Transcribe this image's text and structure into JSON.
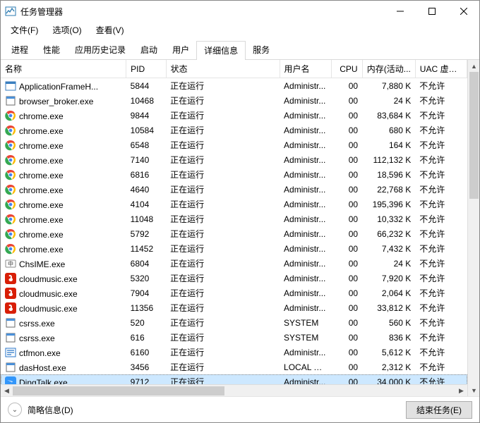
{
  "window": {
    "title": "任务管理器"
  },
  "menu": {
    "file": "文件(F)",
    "options": "选项(O)",
    "view": "查看(V)"
  },
  "tabs": {
    "processes": "进程",
    "performance": "性能",
    "app_history": "应用历史记录",
    "startup": "启动",
    "users": "用户",
    "details": "详细信息",
    "services": "服务"
  },
  "columns": {
    "name": "名称",
    "pid": "PID",
    "status": "状态",
    "user": "用户名",
    "cpu": "CPU",
    "memory": "内存(活动...",
    "uac": "UAC 虚拟化"
  },
  "status_running": "正在运行",
  "uac_disallowed": "不允许",
  "rows": [
    {
      "icon": "app-frame",
      "name": "ApplicationFrameH...",
      "pid": "5844",
      "user": "Administr...",
      "cpu": "00",
      "mem": "7,880 K"
    },
    {
      "icon": "generic-exe",
      "name": "browser_broker.exe",
      "pid": "10468",
      "user": "Administr...",
      "cpu": "00",
      "mem": "24 K"
    },
    {
      "icon": "chrome",
      "name": "chrome.exe",
      "pid": "9844",
      "user": "Administr...",
      "cpu": "00",
      "mem": "83,684 K"
    },
    {
      "icon": "chrome",
      "name": "chrome.exe",
      "pid": "10584",
      "user": "Administr...",
      "cpu": "00",
      "mem": "680 K"
    },
    {
      "icon": "chrome",
      "name": "chrome.exe",
      "pid": "6548",
      "user": "Administr...",
      "cpu": "00",
      "mem": "164 K"
    },
    {
      "icon": "chrome",
      "name": "chrome.exe",
      "pid": "7140",
      "user": "Administr...",
      "cpu": "00",
      "mem": "112,132 K"
    },
    {
      "icon": "chrome",
      "name": "chrome.exe",
      "pid": "6816",
      "user": "Administr...",
      "cpu": "00",
      "mem": "18,596 K"
    },
    {
      "icon": "chrome",
      "name": "chrome.exe",
      "pid": "4640",
      "user": "Administr...",
      "cpu": "00",
      "mem": "22,768 K"
    },
    {
      "icon": "chrome",
      "name": "chrome.exe",
      "pid": "4104",
      "user": "Administr...",
      "cpu": "00",
      "mem": "195,396 K"
    },
    {
      "icon": "chrome",
      "name": "chrome.exe",
      "pid": "11048",
      "user": "Administr...",
      "cpu": "00",
      "mem": "10,332 K"
    },
    {
      "icon": "chrome",
      "name": "chrome.exe",
      "pid": "5792",
      "user": "Administr...",
      "cpu": "00",
      "mem": "66,232 K"
    },
    {
      "icon": "chrome",
      "name": "chrome.exe",
      "pid": "11452",
      "user": "Administr...",
      "cpu": "00",
      "mem": "7,432 K"
    },
    {
      "icon": "ime",
      "name": "ChsIME.exe",
      "pid": "6804",
      "user": "Administr...",
      "cpu": "00",
      "mem": "24 K"
    },
    {
      "icon": "cloudmusic",
      "name": "cloudmusic.exe",
      "pid": "5320",
      "user": "Administr...",
      "cpu": "00",
      "mem": "7,920 K"
    },
    {
      "icon": "cloudmusic",
      "name": "cloudmusic.exe",
      "pid": "7904",
      "user": "Administr...",
      "cpu": "00",
      "mem": "2,064 K"
    },
    {
      "icon": "cloudmusic",
      "name": "cloudmusic.exe",
      "pid": "11356",
      "user": "Administr...",
      "cpu": "00",
      "mem": "33,812 K"
    },
    {
      "icon": "generic-exe",
      "name": "csrss.exe",
      "pid": "520",
      "user": "SYSTEM",
      "cpu": "00",
      "mem": "560 K"
    },
    {
      "icon": "generic-exe",
      "name": "csrss.exe",
      "pid": "616",
      "user": "SYSTEM",
      "cpu": "00",
      "mem": "836 K"
    },
    {
      "icon": "ctfmon",
      "name": "ctfmon.exe",
      "pid": "6160",
      "user": "Administr...",
      "cpu": "00",
      "mem": "5,612 K"
    },
    {
      "icon": "generic-exe",
      "name": "dasHost.exe",
      "pid": "3456",
      "user": "LOCAL SE...",
      "cpu": "00",
      "mem": "2,312 K"
    },
    {
      "icon": "dingtalk",
      "name": "DingTalk.exe",
      "pid": "9712",
      "user": "Administr...",
      "cpu": "00",
      "mem": "34,000 K",
      "selected": true
    }
  ],
  "footer": {
    "fewer_details": "简略信息(D)",
    "end_task": "结束任务(E)"
  }
}
